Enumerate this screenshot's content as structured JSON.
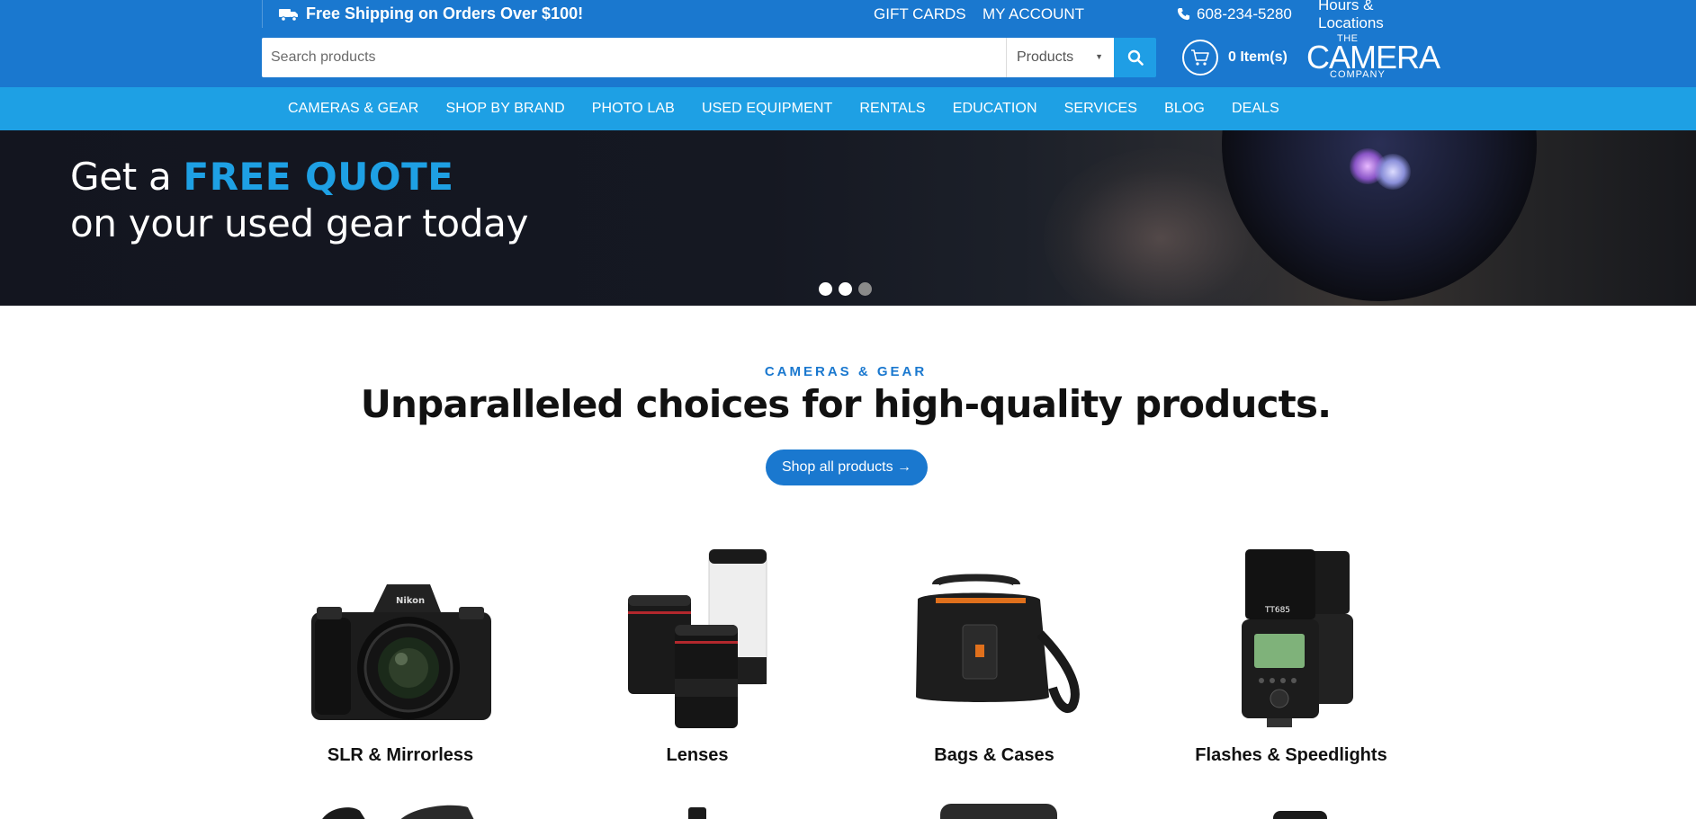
{
  "topbar": {
    "shipping": "Free Shipping on Orders Over $100!",
    "gift_cards": "GIFT CARDS",
    "my_account": "MY ACCOUNT",
    "phone": "608-234-5280",
    "hours": "Hours & Locations"
  },
  "header": {
    "search_placeholder": "Search products",
    "category_selected": "Products",
    "cart_label": "0 Item(s)",
    "logo": {
      "the": "THE",
      "camera": "CAMERA",
      "company": "COMPANY"
    }
  },
  "nav": {
    "items": [
      "CAMERAS & GEAR",
      "SHOP BY BRAND",
      "PHOTO LAB",
      "USED EQUIPMENT",
      "RENTALS",
      "EDUCATION",
      "SERVICES",
      "BLOG",
      "DEALS"
    ]
  },
  "hero": {
    "line1_prefix": "Get a",
    "line1_highlight": "FREE QUOTE",
    "line2": "on your used gear today",
    "slides": 3,
    "active_slide": 1
  },
  "section": {
    "eyebrow": "CAMERAS & GEAR",
    "headline": "Unparalleled choices for high-quality products.",
    "cta": "Shop all products →"
  },
  "categories": [
    {
      "label": "SLR & Mirrorless",
      "icon": "mirrorless-camera-icon"
    },
    {
      "label": "Lenses",
      "icon": "lenses-icon"
    },
    {
      "label": "Bags & Cases",
      "icon": "camera-bag-icon"
    },
    {
      "label": "Flashes & Speedlights",
      "icon": "speedlight-icon"
    }
  ],
  "colors": {
    "primary": "#1a78cf",
    "nav": "#1ea0e4",
    "hero_bg": "#151822"
  }
}
